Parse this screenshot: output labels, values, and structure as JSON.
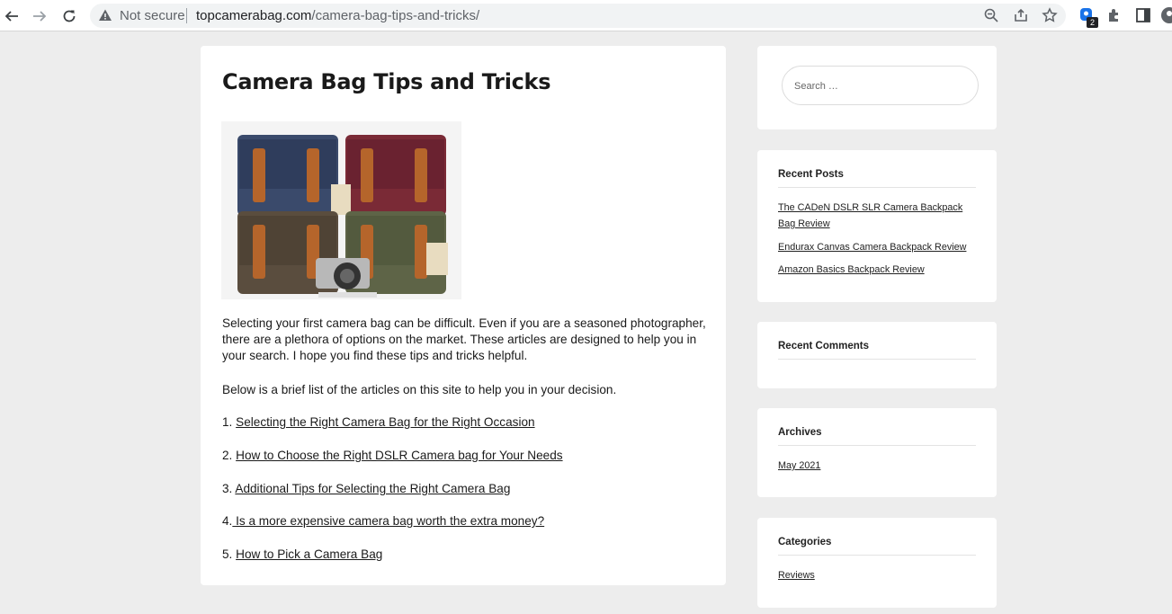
{
  "browser": {
    "security_label": "Not secure",
    "url_domain": "topcamerabag.com",
    "url_path": "/camera-bag-tips-and-tricks/",
    "extension_badge": "2"
  },
  "article": {
    "title": "Camera Bag Tips and Tricks",
    "intro": "Selecting your first camera bag can be difficult. Even if you are a seasoned photographer, there are a plethora of options on the market. These articles are designed to help you in your search. I hope you find these tips and tricks helpful.",
    "list_intro": "Below is a brief list of the articles on this site to help you in your decision.",
    "links": [
      {
        "num": "1.",
        "text": "Selecting the Right Camera Bag for the Right Occasion"
      },
      {
        "num": "2.",
        "text": "How to Choose the Right DSLR Camera bag for Your Needs"
      },
      {
        "num": "3.",
        "text": "Additional Tips for Selecting the Right Camera Bag"
      },
      {
        "num": "4.",
        "text": " Is a more expensive camera bag worth the extra money?"
      },
      {
        "num": "5.",
        "text": "How to Pick a Camera Bag"
      }
    ]
  },
  "sidebar": {
    "search_placeholder": "Search …",
    "recent_posts": {
      "title": "Recent Posts",
      "items": [
        "The CADeN DSLR SLR Camera Backpack Bag Review",
        "Endurax Canvas Camera Backpack Review",
        "Amazon Basics Backpack Review"
      ]
    },
    "recent_comments": {
      "title": "Recent Comments"
    },
    "archives": {
      "title": "Archives",
      "items": [
        "May 2021"
      ]
    },
    "categories": {
      "title": "Categories",
      "items": [
        "Reviews"
      ]
    }
  },
  "icons": [
    "back-arrow-icon",
    "forward-arrow-icon",
    "reload-icon",
    "warning-icon",
    "zoom-icon",
    "share-icon",
    "star-icon",
    "extension-icon",
    "puzzle-icon",
    "sidepanel-icon",
    "profile-icon"
  ]
}
